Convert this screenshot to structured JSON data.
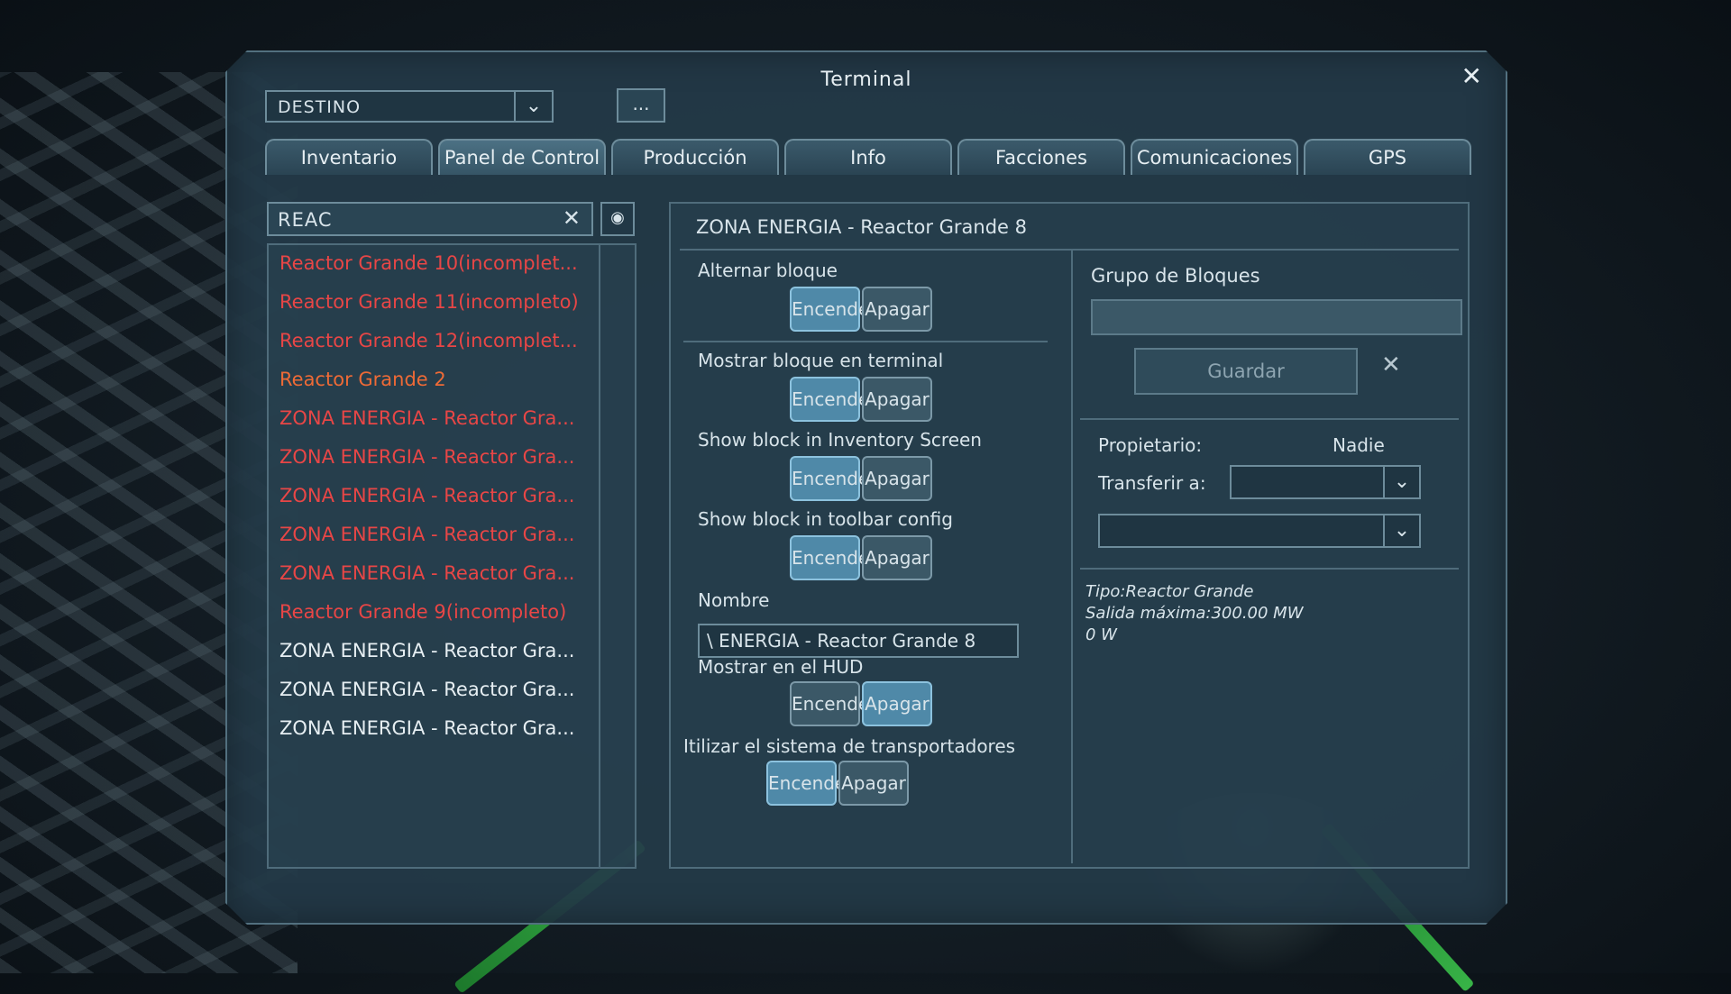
{
  "terminal": {
    "title": "Terminal",
    "destination": "DESTINO",
    "more_label": "...",
    "tabs": [
      "Inventario",
      "Panel de Control",
      "Producción",
      "Info",
      "Facciones",
      "Comunicaciones",
      "GPS"
    ],
    "active_tab": "Panel de Control"
  },
  "search": {
    "value": "REAC"
  },
  "block_list": [
    {
      "label": "Reactor Grande 10(incomplet...",
      "color": "#e84646"
    },
    {
      "label": "Reactor Grande 11(incompleto)",
      "color": "#e84646"
    },
    {
      "label": "Reactor Grande 12(incomplet...",
      "color": "#e84646"
    },
    {
      "label": "Reactor Grande 2",
      "color": "#ee6a36"
    },
    {
      "label": "ZONA ENERGIA - Reactor Gra...",
      "color": "#e84646"
    },
    {
      "label": "ZONA ENERGIA - Reactor Gra...",
      "color": "#e84646"
    },
    {
      "label": "ZONA ENERGIA - Reactor Gra...",
      "color": "#e84646"
    },
    {
      "label": "ZONA ENERGIA - Reactor Gra...",
      "color": "#e84646"
    },
    {
      "label": "ZONA ENERGIA - Reactor Gra...",
      "color": "#e84646"
    },
    {
      "label": "Reactor Grande 9(incompleto)",
      "color": "#e84646"
    },
    {
      "label": "ZONA ENERGIA - Reactor Gra...",
      "color": "#e6eef2"
    },
    {
      "label": "ZONA ENERGIA - Reactor Gra...",
      "color": "#e6eef2"
    },
    {
      "label": "ZONA ENERGIA - Reactor Gra...",
      "color": "#e6eef2"
    }
  ],
  "panel": {
    "title": "ZONA ENERGIA - Reactor Grande 8",
    "on_label": "Encender",
    "off_label": "Apagar",
    "toggles": [
      {
        "label": "Alternar bloque",
        "state": "on"
      },
      {
        "label": "Mostrar bloque en terminal",
        "state": "on"
      },
      {
        "label": "Show block in Inventory Screen",
        "state": "on"
      },
      {
        "label": "Show block in toolbar config",
        "state": "on"
      },
      {
        "label": "Mostrar en el HUD",
        "state": "off"
      },
      {
        "label": "Itilizar el sistema de transportadores",
        "state": "on"
      }
    ],
    "name_label": "Nombre",
    "name_value": "\\ ENERGIA - Reactor Grande 8"
  },
  "groups": {
    "title": "Grupo de Bloques",
    "input_value": "",
    "save_label": "Guardar",
    "owner_label": "Propietario:",
    "owner_value": "Nadie",
    "transfer_label": "Transferir a:",
    "transfer_value": "",
    "share_value": ""
  },
  "details": {
    "type": "Tipo:Reactor Grande",
    "max_output": "Salida máxima:300.00 MW",
    "current_output": "0 W"
  }
}
